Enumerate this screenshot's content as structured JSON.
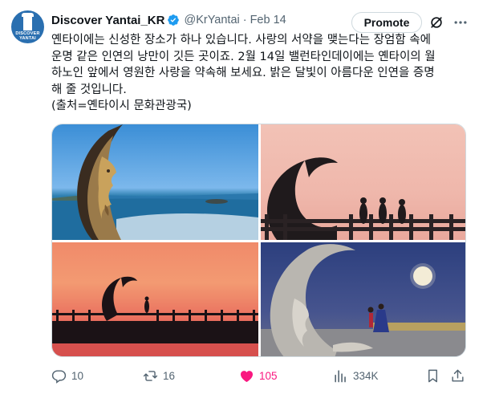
{
  "account": {
    "name": "Discover Yantai_KR",
    "handle": "@KrYantai",
    "separator": "·",
    "date": "Feb 14",
    "avatar_wordmark_line1": "DISCOVER",
    "avatar_wordmark_line2": "YANTAI"
  },
  "promote_label": "Promote",
  "post": {
    "lines": [
      "옌타이에는 신성한 장소가 하나 있습니다. 사랑의 서약을 맺는다는 장엄함 속에",
      "운명 같은 인연의 낭만이 깃든 곳이죠. 2월 14일 밸런타인데이에는 옌타이의 월",
      "하노인 앞에서 영원한 사랑을 약속해 보세요. 밝은 달빛이 아름다운 인연을 증명",
      "해 줄 것입니다.",
      "(출처=옌타이시 문화관광국)"
    ]
  },
  "icons": {
    "verified": "verified-badge-icon",
    "grok": "grok-icon",
    "more": "more-icon",
    "reply": "reply-icon",
    "repost": "repost-icon",
    "like": "heart-icon",
    "views": "views-icon",
    "bookmark": "bookmark-icon",
    "share": "share-icon"
  },
  "colors": {
    "verified_blue": "#1d9bf0",
    "like_pink": "#f91880",
    "secondary_text": "#536471",
    "border": "#cfd9de"
  },
  "stats": {
    "replies": "10",
    "reposts": "16",
    "likes": "105",
    "views": "334K"
  }
}
